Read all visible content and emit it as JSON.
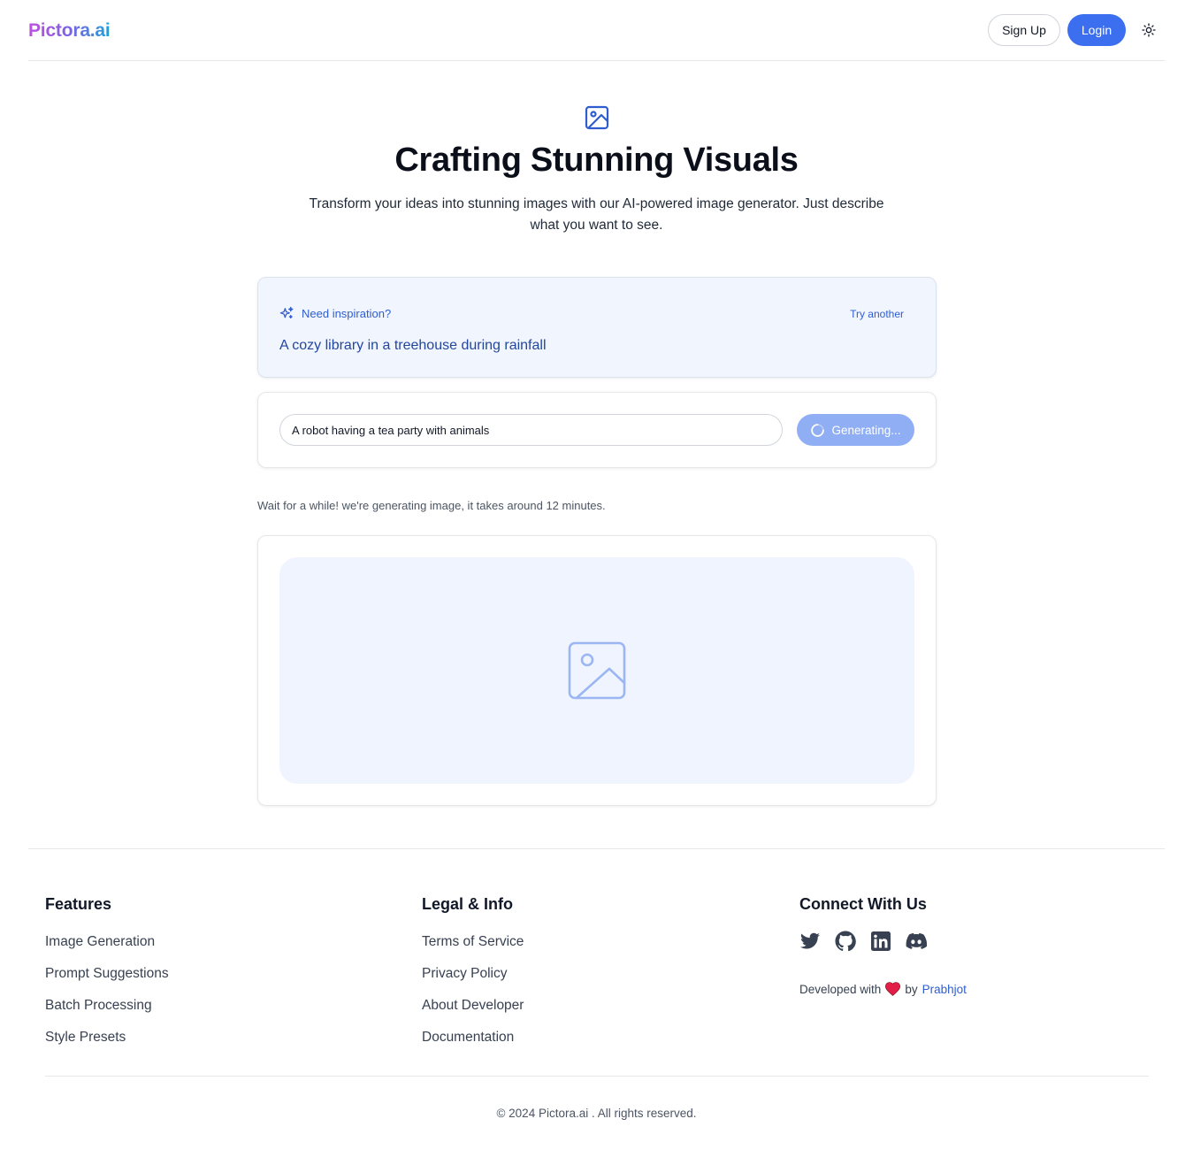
{
  "header": {
    "logo": "Pictora.ai",
    "signup_label": "Sign Up",
    "login_label": "Login",
    "theme_icon": "sun-icon"
  },
  "hero": {
    "icon": "image-icon",
    "title": "Crafting Stunning Visuals",
    "subtitle": "Transform your ideas into stunning images with our AI-powered image generator. Just describe what you want to see."
  },
  "inspiration": {
    "icon": "sparkles-icon",
    "label": "Need inspiration?",
    "try_label": "Try another",
    "suggestion": "A cozy library in a treehouse during rainfall"
  },
  "prompt": {
    "value": "A robot having a tea party with animals",
    "button_label": "Generating...",
    "button_icon": "spinner-icon"
  },
  "status": {
    "wait_text": "Wait for a while! we're generating image, it takes around 12 minutes."
  },
  "image_area": {
    "placeholder_icon": "image-placeholder-icon"
  },
  "footer": {
    "features": {
      "title": "Features",
      "links": [
        "Image Generation",
        "Prompt Suggestions",
        "Batch Processing",
        "Style Presets"
      ]
    },
    "legal": {
      "title": "Legal & Info",
      "links": [
        "Terms of Service",
        "Privacy Policy",
        "About Developer",
        "Documentation"
      ]
    },
    "connect": {
      "title": "Connect With Us",
      "socials": [
        "twitter-icon",
        "github-icon",
        "linkedin-icon",
        "discord-icon"
      ],
      "developed_prefix": "Developed with",
      "developed_by": "by",
      "developer_name": "Prabhjot"
    },
    "copyright": "© 2024 Pictora.ai . All rights reserved."
  },
  "colors": {
    "accent": "#3b6ff0",
    "accent_disabled": "#90aef4",
    "link": "#2f5dd0",
    "placeholder_bg": "#eff4fe",
    "heart": "#e11d48"
  }
}
